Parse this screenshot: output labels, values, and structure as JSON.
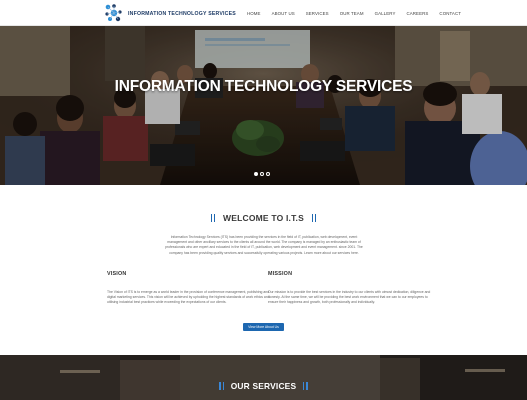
{
  "brand": {
    "name": "INFORMATION TECHNOLOGY SERVICES"
  },
  "nav": {
    "items": [
      "HOME",
      "ABOUT US",
      "SERVICES",
      "OUR TEAM",
      "GALLERY",
      "CAREERS",
      "CONTACT"
    ]
  },
  "hero": {
    "title": "INFORMATION TECHNOLOGY SERVICES",
    "slides": 3,
    "active_slide": 1
  },
  "welcome": {
    "title": "WELCOME TO I.T.S",
    "intro": "Information Technology Services (ITS) has been providing the services in the field of IT, publication, web development, event management and other ancillary services to the clients all around the world. The company is managed by an enthusiastic team of professionals who are expert and educated in the field of IT, publication, web development and event management. since 2001. The company has been providing quality services and successfully operating various projects. Learn more about our services here.",
    "vision_heading": "VISION",
    "vision_text": "The Vision of ITS is to emerge as a world leader in the provision of conference management, publishing and digital marketing services. This vision will be achieved by upholding the highest standards of work ethics and utilising industrial best practices while exceeding the expectations of our clients.",
    "mission_heading": "MISSION",
    "mission_text": "Our mission is to provide the best services in the industry to our clients with utmost dedication, diligence and honesty. At the same time, we will be providing the best work environment that we can to our employees to ensure their happiness and growth, both professionally and individually.",
    "button_label": "View More About Us"
  },
  "services": {
    "title": "OUR SERVICES"
  },
  "colors": {
    "accent": "#1d67b0",
    "heading": "#3a3a3a",
    "text": "#666666"
  }
}
